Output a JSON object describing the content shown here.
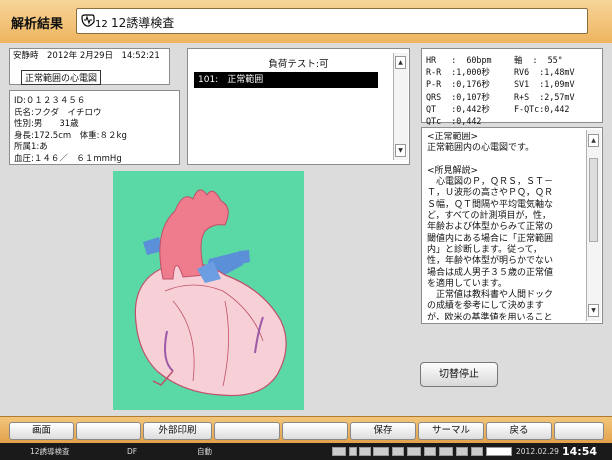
{
  "header": {
    "app_title": "解析結果",
    "test_name": "12誘導検査",
    "test_icon": "ecg-12-lead-icon"
  },
  "patient_time": {
    "line": "安静時　2012年 2月29日　14:52:21",
    "interpretation": "正常範囲の心電図"
  },
  "patient": {
    "lines": [
      "ID:０１２３４５６",
      "氏名:フクダ　イチロウ",
      "性別:男　　31歳",
      "身長:172.5cm　体重:８２kg",
      "所属1:あ",
      "血圧:１４６／　６１mmHg"
    ]
  },
  "load_test": {
    "title": "負荷テスト:可",
    "selected_item": "101:　正常範囲"
  },
  "measurements": {
    "left": "HR   :  60bpm\nR-R  :1,000秒\nP-R  :0,176秒\nQRS  :0,107秒\nQT   :0,442秒\nQTc  :0,442",
    "right": "軸  :  55°\nRV6  :1,48mV\nSV1  :1,09mV\nR+S  :2,57mV\nF-QTc:0,442"
  },
  "comment": {
    "text": "<正常範囲>\n正常範囲内の心電図です。\n\n<所見解説>\n　心電図のＰ，ＱＲＳ，ＳＴ－\nＴ，Ｕ波形の高さやＰＱ，ＱＲ\nＳ幅，ＱＴ間隔や平均電気軸な\nど，すべての計測項目が，性，\n年齢および体型からみて正常の\n閾値内にある場合に「正常範囲\n内」と診断します。従って，\n性，年齢や体型が明らかでない\n場合は成人男子３５歳の正常値\nを適用しています。\n　正常値は教科書や人間ドック\nの成績を参考にして決めます\nが，欧米の基準値を用いること\nが多く，人種差を考慮しなけれ\nばなりません。特に欧米の左室"
  },
  "switch_stop_label": "切替停止",
  "function_buttons": [
    "画面",
    "",
    "外部印刷",
    "",
    "",
    "保存",
    "サーマル",
    "戻る",
    ""
  ],
  "status": {
    "test": "12誘導検査",
    "mode": "DF",
    "auto": "自動",
    "date": "2012.02.29",
    "time": "14:54"
  },
  "colors": {
    "title_bar": "#eeb45e",
    "heart_background": "#5ad8a6",
    "heart_pink": "#f2a0ac",
    "aorta": "#ee7c8c",
    "vein_blue": "#5b8fd8"
  }
}
